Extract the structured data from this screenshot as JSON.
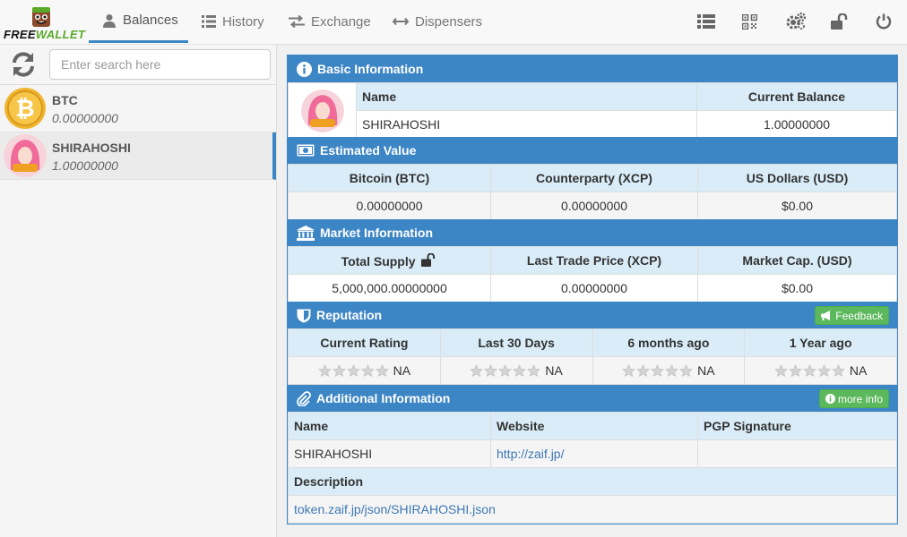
{
  "app": {
    "logo_free": "FREE",
    "logo_wallet": "WALLET"
  },
  "nav": {
    "tabs": [
      {
        "label": "Balances",
        "icon": "user-icon",
        "active": true
      },
      {
        "label": "History",
        "icon": "list-icon"
      },
      {
        "label": "Exchange",
        "icon": "exchange-icon"
      },
      {
        "label": "Dispensers",
        "icon": "dispenser-icon"
      }
    ],
    "tools": [
      "list-view-icon",
      "qr-code-icon",
      "settings-icon",
      "unlock-icon",
      "power-icon"
    ]
  },
  "sidebar": {
    "search_placeholder": "Enter search here",
    "search_value": "",
    "assets": [
      {
        "name": "BTC",
        "balance": "0.00000000",
        "icon": "bitcoin-icon"
      },
      {
        "name": "SHIRAHOSHI",
        "balance": "1.00000000",
        "icon": "shirahoshi-token-icon",
        "selected": true
      }
    ]
  },
  "basic_info": {
    "title": "Basic Information",
    "col_name": "Name",
    "col_balance": "Current Balance",
    "name": "SHIRAHOSHI",
    "balance": "1.00000000"
  },
  "estimated_value": {
    "title": "Estimated Value",
    "col_btc": "Bitcoin (BTC)",
    "col_xcp": "Counterparty (XCP)",
    "col_usd": "US Dollars (USD)",
    "btc": "0.00000000",
    "xcp": "0.00000000",
    "usd": "$0.00"
  },
  "market_info": {
    "title": "Market Information",
    "col_supply": "Total Supply",
    "col_last": "Last Trade Price (XCP)",
    "col_cap": "Market Cap. (USD)",
    "supply": "5,000,000.00000000",
    "last": "0.00000000",
    "cap": "$0.00"
  },
  "reputation": {
    "title": "Reputation",
    "feedback_label": "Feedback",
    "columns": [
      "Current Rating",
      "Last 30 Days",
      "6 months ago",
      "1 Year ago"
    ],
    "ratings": [
      "NA",
      "NA",
      "NA",
      "NA"
    ]
  },
  "additional_info": {
    "title": "Additional Information",
    "more_info_label": "more info",
    "col_name": "Name",
    "col_website": "Website",
    "col_pgp": "PGP Signature",
    "name": "SHIRAHOSHI",
    "website": "http://zaif.jp/",
    "pgp": "",
    "description_label": "Description",
    "description": "token.zaif.jp/json/SHIRAHOSHI.json"
  },
  "colors": {
    "accent": "#3d86c6",
    "header_cell": "#d9ecf7",
    "success": "#5cb85c",
    "link": "#3d78b5"
  }
}
